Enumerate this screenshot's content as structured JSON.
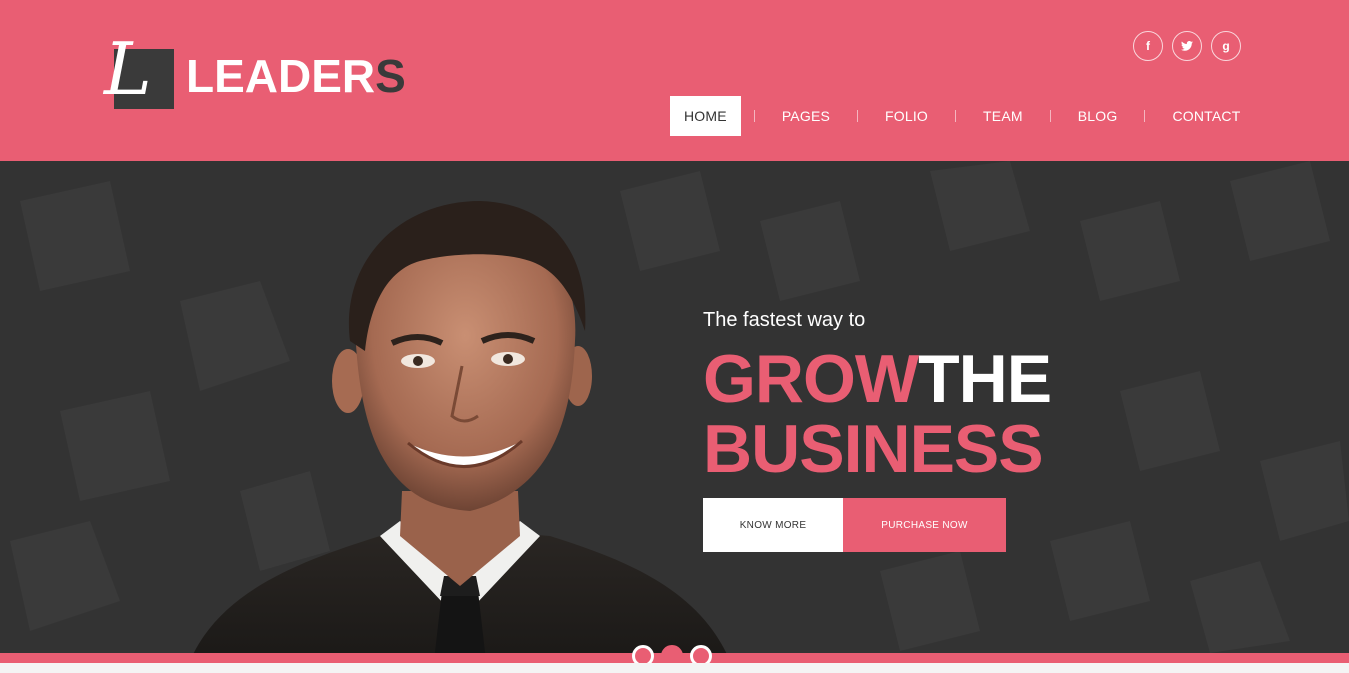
{
  "brand": {
    "logo_mark": "L",
    "logo_text_main": "LEADER",
    "logo_text_last": "S"
  },
  "social": [
    {
      "icon": "facebook-icon",
      "glyph": "f"
    },
    {
      "icon": "twitter-icon",
      "glyph": "t"
    },
    {
      "icon": "google-plus-icon",
      "glyph": "g"
    }
  ],
  "nav": {
    "items": [
      {
        "label": "HOME",
        "active": true
      },
      {
        "label": "PAGES",
        "active": false
      },
      {
        "label": "FOLIO",
        "active": false
      },
      {
        "label": "TEAM",
        "active": false
      },
      {
        "label": "BLOG",
        "active": false
      },
      {
        "label": "CONTACT",
        "active": false
      }
    ]
  },
  "hero": {
    "tagline": "The fastest way to",
    "headline_pink_1": "GROW",
    "headline_white": "THE",
    "headline_pink_2": "BUSINESS",
    "cta_primary": "KNOW MORE",
    "cta_secondary": "PURCHASE NOW"
  },
  "slider": {
    "dot_count": 3,
    "active_index": 1
  },
  "colors": {
    "accent": "#e95e73",
    "dark": "#333333",
    "logo_box": "#3a3a3a"
  }
}
